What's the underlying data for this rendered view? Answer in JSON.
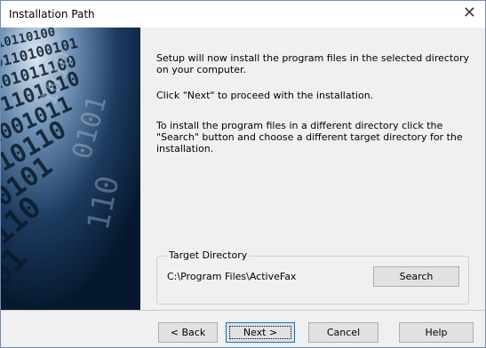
{
  "window": {
    "title": "Installation Path"
  },
  "content": {
    "intro": "Setup will now install the program files in the selected directory on your computer.",
    "next_hint": "Click \"Next\" to proceed with the installation.",
    "different_dir": "To install the program files in a different directory click the \"Search\" button and choose a different target directory for the installation."
  },
  "target": {
    "legend": "Target Directory",
    "path": "C:\\Program Files\\ActiveFax",
    "search_label": "Search"
  },
  "buttons": {
    "back_label": "< Back",
    "next_label": "Next >",
    "cancel_label": "Cancel",
    "help_label": "Help"
  },
  "colors": {
    "accent": "#0078d7",
    "banner": "#0d2a4a"
  }
}
